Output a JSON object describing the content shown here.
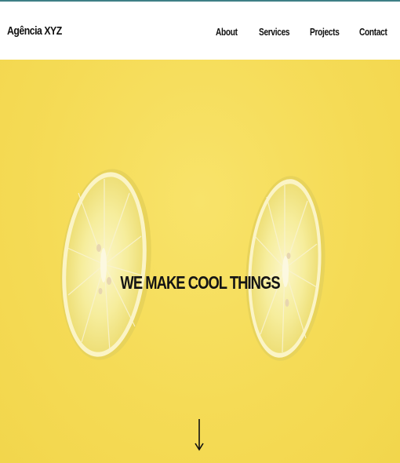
{
  "header": {
    "brand": "Agência XYZ",
    "nav": [
      {
        "label": "About"
      },
      {
        "label": "Services"
      },
      {
        "label": "Projects"
      },
      {
        "label": "Contact"
      }
    ]
  },
  "hero": {
    "title": "WE MAKE COOL THINGS",
    "scroll_icon": "arrow-down-icon",
    "background_color": "#f6dd58"
  },
  "colors": {
    "accent": "#3e7f86",
    "text": "#111111",
    "nav_bg": "#ffffff"
  }
}
